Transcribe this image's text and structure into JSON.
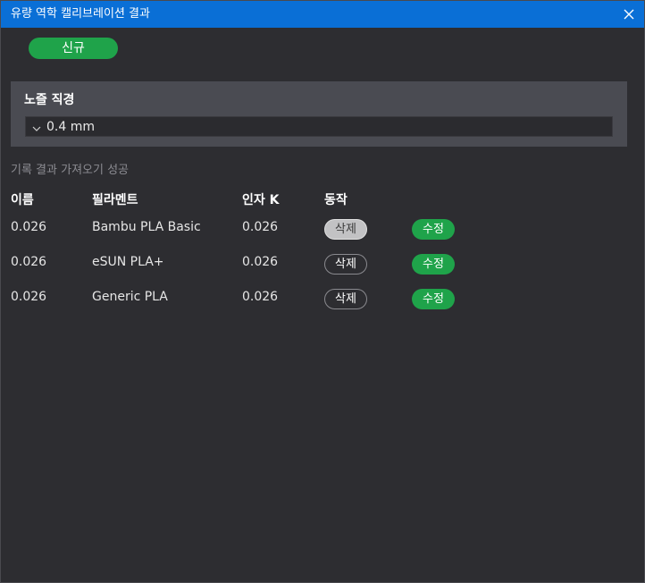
{
  "window": {
    "title": "유량 역학 캘리브레이션 결과"
  },
  "toolbar": {
    "new_label": "신규"
  },
  "nozzle": {
    "label": "노즐 직경",
    "selected": "0.4 mm"
  },
  "status_text": "기록 결과 가져오기 성공",
  "table": {
    "headers": {
      "name": "이름",
      "filament": "필라멘트",
      "factor": "인자 K",
      "action": "동작"
    },
    "rows": [
      {
        "name": "0.026",
        "filament": "Bambu PLA Basic",
        "factor": "0.026",
        "delete_label": "삭제",
        "edit_label": "수정"
      },
      {
        "name": "0.026",
        "filament": "eSUN PLA+",
        "factor": "0.026",
        "delete_label": "삭제",
        "edit_label": "수정"
      },
      {
        "name": "0.026",
        "filament": "Generic PLA",
        "factor": "0.026",
        "delete_label": "삭제",
        "edit_label": "수정"
      }
    ]
  },
  "colors": {
    "titlebar": "#0a6fd6",
    "accent_green": "#1fa34a",
    "background": "#2d2d31",
    "panel": "#4a4b52"
  },
  "icons": {
    "close": "close-icon",
    "dropdown": "chevron-down-icon"
  }
}
